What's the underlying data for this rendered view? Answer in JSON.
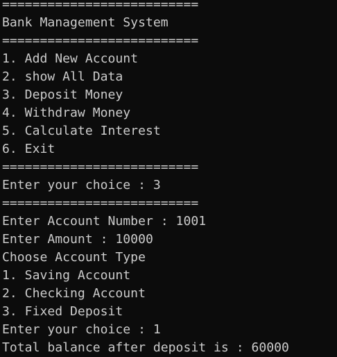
{
  "terminal": {
    "lines": [
      "==========================",
      "Bank Management System",
      "==========================",
      "1. Add New Account",
      "2. show All Data",
      "3. Deposit Money",
      "4. Withdraw Money",
      "5. Calculate Interest",
      "6. Exit",
      "==========================",
      "Enter your choice : 3",
      "==========================",
      "Enter Account Number : 1001",
      "Enter Amount : 10000",
      "Choose Account Type",
      "1. Saving Account",
      "2. Checking Account",
      "3. Fixed Deposit",
      "Enter your choice : 1",
      "Total balance after deposit is : 60000"
    ]
  },
  "colors": {
    "background": "#0c0c0c",
    "text": "#cccccc"
  }
}
